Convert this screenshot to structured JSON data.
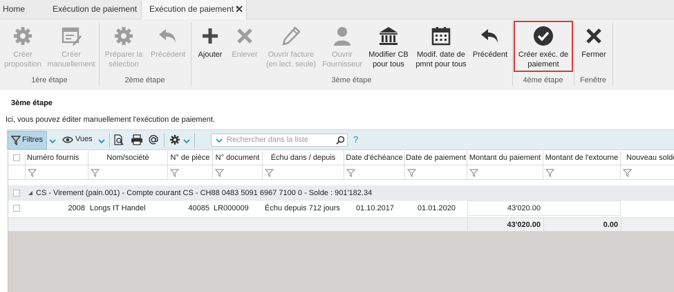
{
  "tabs": [
    {
      "label": "Home"
    },
    {
      "label": "Exécution de paiement"
    },
    {
      "label": "Exécution de paiement *",
      "active": true
    }
  ],
  "ribbon": {
    "buttons": [
      {
        "label": "Créer\nproposition",
        "icon": "gear-icon",
        "enabled": false
      },
      {
        "label": "Créer\nmanuellement",
        "icon": "edit-form-icon",
        "enabled": false
      },
      {
        "label": "Préparer la\nsélection",
        "icon": "gear-icon",
        "enabled": false
      },
      {
        "label": "Précédent",
        "icon": "undo-arrow-icon",
        "enabled": false
      },
      {
        "label": "Ajouter",
        "icon": "plus-icon",
        "enabled": true
      },
      {
        "label": "Enlever",
        "icon": "x-icon",
        "enabled": false
      },
      {
        "label": "Ouvrir facture\n(en lect. seule)",
        "icon": "pencil-icon",
        "enabled": false
      },
      {
        "label": "Ouvrir\nFournisseur",
        "icon": "person-icon",
        "enabled": false
      },
      {
        "label": "Modifier CB\npour tous",
        "icon": "bank-icon",
        "enabled": true
      },
      {
        "label": "Modif. date de\npmnt pour tous",
        "icon": "calendar-icon",
        "enabled": true
      },
      {
        "label": "Précédent",
        "icon": "undo-arrow-icon",
        "enabled": true
      },
      {
        "label": "Créer exéc. de\npaiement",
        "icon": "checkmark-circle-icon",
        "enabled": true
      },
      {
        "label": "Fermer",
        "icon": "x-icon",
        "enabled": true
      }
    ],
    "groups": [
      "1ère étape",
      "2ème étape",
      "3ème étape",
      "4ème étape",
      "Fenêtre"
    ]
  },
  "section": {
    "title": "3ème étape",
    "description": "Ici, vous pouvez éditer manuellement l'exécution de paiement."
  },
  "toolbar": {
    "filters_label": "Filtres",
    "views_label": "Vues",
    "search_placeholder": "Rechercher dans la liste",
    "help": "?"
  },
  "table": {
    "columns": [
      "Numéro fournis",
      "Nom/société",
      "N° de pièce",
      "N° document",
      "Échu dans / depuis",
      "Date d'échéance",
      "Date de paiement",
      "Montant du paiement",
      "Montant de l'extourne",
      "Nouveau solde"
    ],
    "group_label": "CS - Virement (pain.001) - Compte courant CS - CH88 0483 5091 6967 7100 0 - Solde : 901'182.34",
    "rows": [
      {
        "supplier_no": "2008",
        "name": "Longs IT Handel",
        "piece_no": "40085",
        "document_no": "LR000009",
        "due": "Échu depuis 712 jours",
        "due_date": "01.10.2017",
        "payment_date": "01.01.2020",
        "payment_amount": "43'020.00",
        "reversal_amount": ""
      }
    ],
    "totals": {
      "payment_amount": "43'020.00",
      "reversal_amount": "0.00"
    }
  },
  "colors": {
    "accent": "#1b8fc2",
    "highlight": "#d83a3a",
    "disabled": "#a5a5a5",
    "ribbon_bg": "#f0f0f0"
  }
}
